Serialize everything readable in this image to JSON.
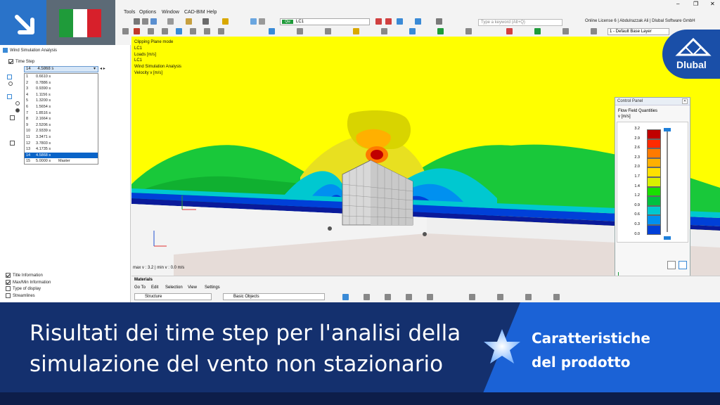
{
  "menu": {
    "items": [
      "Tools",
      "Options",
      "Window",
      "CAD-BIM",
      "Help"
    ],
    "search_placeholder": "Type a keyword (Alt+Q)",
    "license": "Online License 6 | Abdulrazzak Ali | Dlubal Software GmbH",
    "load_case_tag": "Qw",
    "load_case": "LC1",
    "base_layer": "1 - Default Base Layer"
  },
  "navigator": {
    "title": "Wind Simulation Analysis",
    "time_step_label": "Time Step",
    "selected_index": "14",
    "selected_value": "4.5868 s",
    "steps": [
      {
        "i": "1",
        "t": "0.6610 s",
        "note": ""
      },
      {
        "i": "2",
        "t": "0.7886 s",
        "note": ""
      },
      {
        "i": "3",
        "t": "0.9390 s",
        "note": ""
      },
      {
        "i": "4",
        "t": "1.1156 s",
        "note": ""
      },
      {
        "i": "5",
        "t": "1.3200 s",
        "note": ""
      },
      {
        "i": "6",
        "t": "1.5654 s",
        "note": ""
      },
      {
        "i": "7",
        "t": "1.8516 s",
        "note": ""
      },
      {
        "i": "8",
        "t": "2.1664 s",
        "note": ""
      },
      {
        "i": "9",
        "t": "2.5206 s",
        "note": ""
      },
      {
        "i": "10",
        "t": "2.9339 s",
        "note": ""
      },
      {
        "i": "11",
        "t": "3.3471 s",
        "note": ""
      },
      {
        "i": "12",
        "t": "3.7803 s",
        "note": ""
      },
      {
        "i": "13",
        "t": "4.1735 s",
        "note": ""
      },
      {
        "i": "14",
        "t": "4.5868 s",
        "note": ""
      },
      {
        "i": "15",
        "t": "5.0000 s",
        "note": "Master"
      }
    ],
    "bottom_items": [
      "Title Information",
      "Max/Min Information",
      "Type of display",
      "Streamlines"
    ]
  },
  "viewport": {
    "info_lines": [
      "Clipping Plane mode",
      "LC1",
      "Loads [m/s]",
      "LC1",
      "Wind Simulation Analysis",
      "Velocity v [m/s]"
    ],
    "status": "max v : 3.2 | min v : 0.0 m/s",
    "bg_color": "#ffff00"
  },
  "control_panel": {
    "title": "Control Panel",
    "heading": "Flow Field Quantities",
    "unit": "v [m/s]",
    "scale_values": [
      "3.2",
      "2.9",
      "2.6",
      "2.3",
      "2.0",
      "1.7",
      "1.4",
      "1.2",
      "0.9",
      "0.6",
      "0.3",
      "0.0"
    ],
    "scale_colors": [
      "#c00000",
      "#ff2a00",
      "#ff7a00",
      "#ffb000",
      "#ffe000",
      "#d8f000",
      "#19e000",
      "#00c040",
      "#00c8d0",
      "#0090f0",
      "#0040d8",
      "#00109a"
    ]
  },
  "materials": {
    "title": "Materials",
    "menu": [
      "Go To",
      "Edit",
      "Selection",
      "View",
      "Settings"
    ],
    "drop1": "Structure",
    "drop2": "Basic Objects"
  },
  "banner": {
    "line1": "Risultati dei time step per l'analisi della",
    "line2": "simulazione del vento non stazionario",
    "right1": "Caratteristiche",
    "right2": "del prodotto"
  },
  "brand": {
    "name": "Dlubal"
  }
}
